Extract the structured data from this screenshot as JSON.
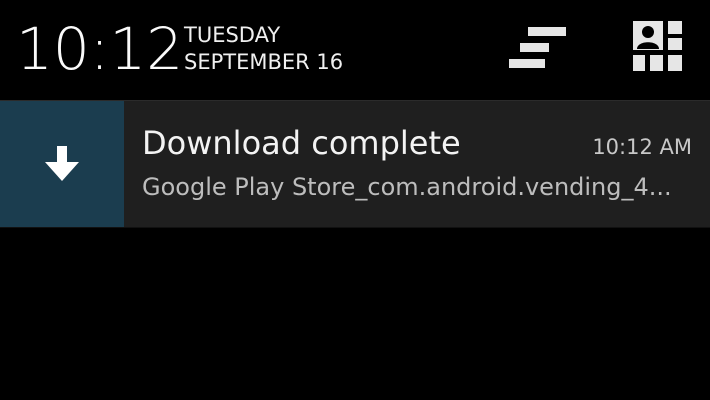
{
  "header": {
    "time": "10:12",
    "day": "TUESDAY",
    "date": "SEPTEMBER 16",
    "settings_icon": "quick-settings-icon",
    "profile_icon": "profile-grid-icon"
  },
  "notification": {
    "icon": "download-arrow-icon",
    "title": "Download complete",
    "time": "10:12 AM",
    "subtitle": "Google Play Store_com.android.vending_4...",
    "icon_bg_color": "#1b3d4f"
  }
}
